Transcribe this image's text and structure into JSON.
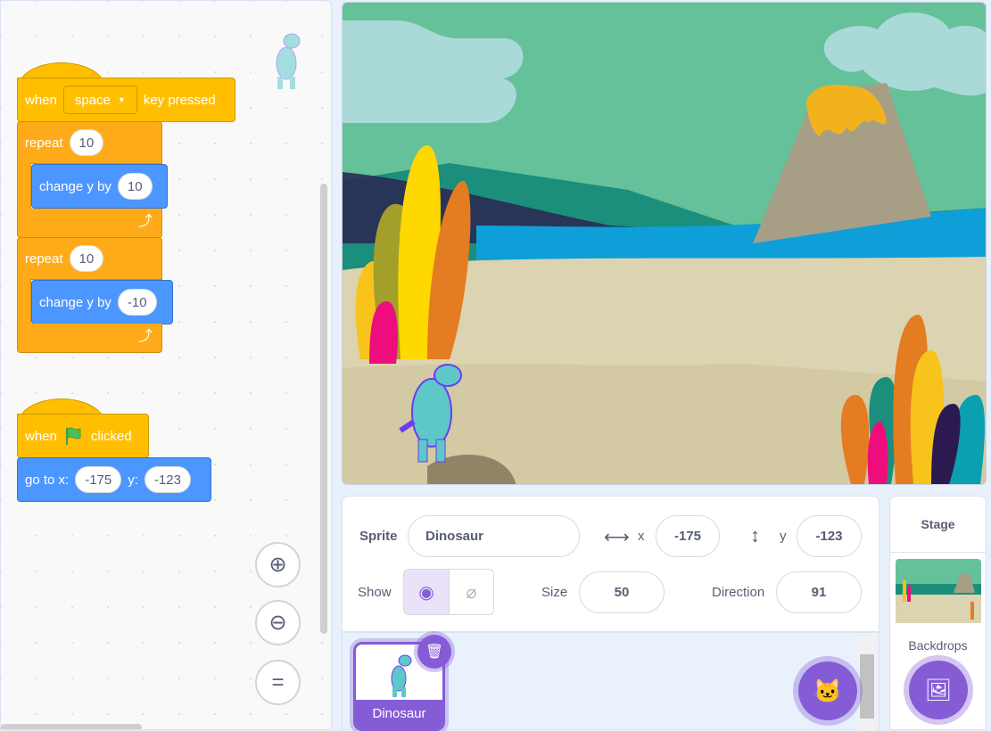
{
  "code_area": {
    "script1": {
      "hat_when": "when",
      "key": "space",
      "hat_rest": "key pressed",
      "repeat1": {
        "label": "repeat",
        "count": "10",
        "inner_label": "change y by",
        "inner_value": "10"
      },
      "repeat2": {
        "label": "repeat",
        "count": "10",
        "inner_label": "change y by",
        "inner_value": "-10"
      }
    },
    "script2": {
      "hat_when": "when",
      "hat_rest": "clicked",
      "goto_label": "go to x:",
      "x": "-175",
      "y_label": "y:",
      "y": "-123"
    },
    "zoom_in_icon": "zoom-in",
    "zoom_out_icon": "zoom-out",
    "reset_icon": "equals"
  },
  "sprite_info": {
    "sprite_label": "Sprite",
    "sprite_name": "Dinosaur",
    "x_label": "x",
    "x": "-175",
    "y_label": "y",
    "y": "-123",
    "show_label": "Show",
    "size_label": "Size",
    "size": "50",
    "direction_label": "Direction",
    "direction": "91"
  },
  "sprite_list": {
    "items": [
      {
        "name": "Dinosaur",
        "selected": true
      }
    ]
  },
  "stage_pane": {
    "title": "Stage",
    "backdrops_label": "Backdrops"
  },
  "colors": {
    "events": "#ffbf00",
    "control": "#ffab19",
    "motion": "#4c97ff",
    "accent": "#855cd6"
  }
}
